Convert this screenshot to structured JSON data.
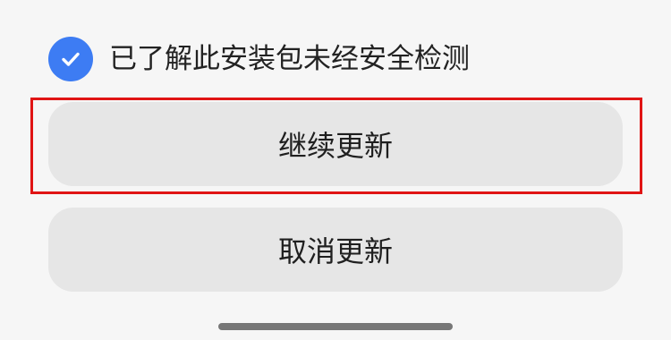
{
  "theme": {
    "accent": "#3d7cf3",
    "highlight": "#e01414"
  },
  "consent": {
    "checked": true,
    "icon": "checkmark-icon",
    "text": "已了解此安装包未经安全检测"
  },
  "actions": {
    "continue_label": "继续更新",
    "cancel_label": "取消更新"
  }
}
